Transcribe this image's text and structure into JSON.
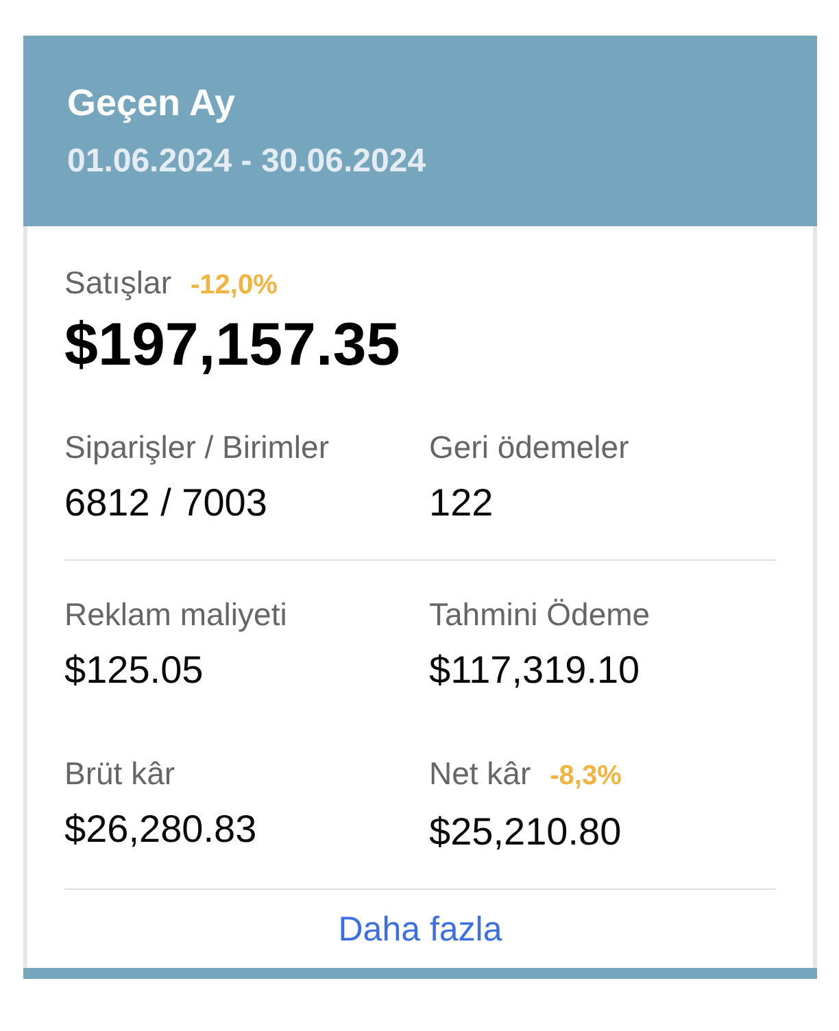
{
  "header": {
    "title": "Geçen Ay",
    "date_range": "01.06.2024 - 30.06.2024"
  },
  "sales": {
    "label": "Satışlar",
    "change": "-12,0%",
    "value": "$197,157.35"
  },
  "metric_groups": [
    [
      {
        "label": "Siparişler / Birimler",
        "value": "6812 / 7003"
      },
      {
        "label": "Geri ödemeler",
        "value": "122"
      }
    ],
    [
      {
        "label": "Reklam maliyeti",
        "value": "$125.05"
      },
      {
        "label": "Tahmini Ödeme",
        "value": "$117,319.10"
      },
      {
        "label": "Brüt kâr",
        "value": "$26,280.83"
      },
      {
        "label": "Net kâr",
        "change": "-8,3%",
        "value": "$25,210.80"
      }
    ]
  ],
  "more_link": "Daha fazla"
}
